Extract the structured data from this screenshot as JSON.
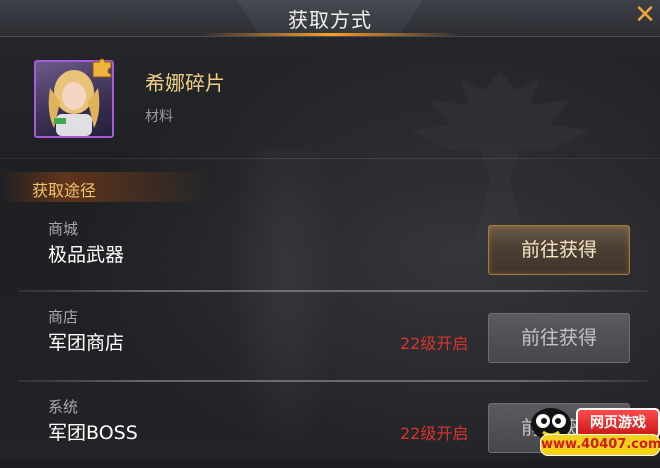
{
  "dialog": {
    "title": "获取方式"
  },
  "item": {
    "name": "希娜碎片",
    "type": "材料"
  },
  "section": {
    "label": "获取途径"
  },
  "rows": [
    {
      "category": "商城",
      "name": "极品武器",
      "lock": "",
      "button": "前往获得",
      "state": "active"
    },
    {
      "category": "商店",
      "name": "军团商店",
      "lock": "22级开启",
      "button": "前往获得",
      "state": "disabled"
    },
    {
      "category": "系统",
      "name": "军团BOSS",
      "lock": "22级开启",
      "button": "前往获得",
      "state": "disabled"
    }
  ],
  "watermark": {
    "badge": "网页游戏",
    "url": "www.40407.com"
  },
  "colors": {
    "accent": "#f2a43a",
    "item_name": "#f0cf85",
    "lock_text": "#d8342c",
    "rarity_border": "#a65cd9"
  },
  "icons": {
    "close": "close-icon",
    "puzzle": "puzzle-piece-icon"
  }
}
